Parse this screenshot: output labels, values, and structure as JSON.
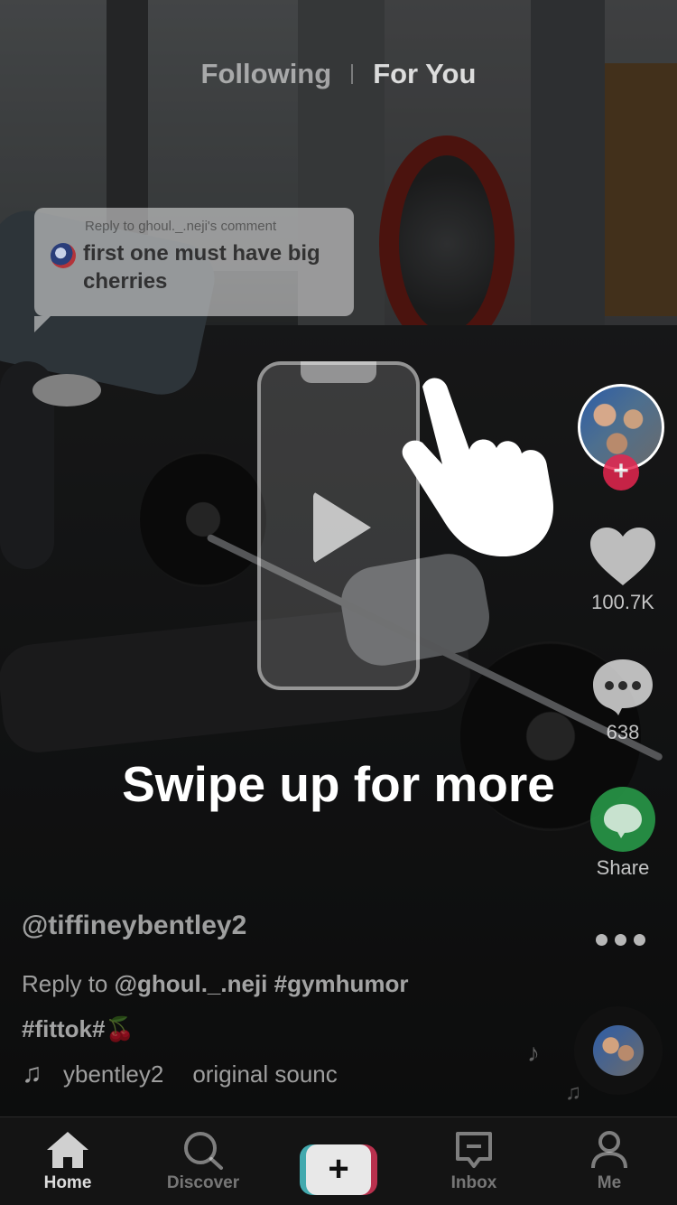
{
  "top_tabs": {
    "following": "Following",
    "for_you": "For You",
    "active": "for_you"
  },
  "reply_bubble": {
    "header": "Reply to ghoul._.neji's comment",
    "comment": "first one must have big cherries"
  },
  "overlay": {
    "swipe_hint": "Swipe up for more",
    "icons": [
      "phone-outline-icon",
      "play-icon",
      "pointing-hand-icon"
    ]
  },
  "actions": {
    "like_count": "100.7K",
    "comment_count": "638",
    "share_label": "Share",
    "follow_icon": "plus-icon"
  },
  "caption": {
    "username": "@tiffineybentley2",
    "line1_prefix": "Reply to ",
    "mention": "@ghoul._.neji",
    "hashtag1": "#gymhumor",
    "hashtag2": "#fittok#",
    "emoji": "🍒",
    "sound_artist": "ybentley2",
    "sound_title": "original sounc"
  },
  "bottom_nav": {
    "items": [
      {
        "label": "Home",
        "icon": "home-icon",
        "active": true
      },
      {
        "label": "Discover",
        "icon": "search-icon",
        "active": false
      },
      {
        "label": "",
        "icon": "create-plus-icon",
        "active": false
      },
      {
        "label": "Inbox",
        "icon": "inbox-icon",
        "active": false
      },
      {
        "label": "Me",
        "icon": "profile-icon",
        "active": false
      }
    ]
  },
  "colors": {
    "follow_red": "#e6264f",
    "share_green": "#2aa94f",
    "create_cyan": "#4ac3c9",
    "create_pink": "#d63658"
  }
}
